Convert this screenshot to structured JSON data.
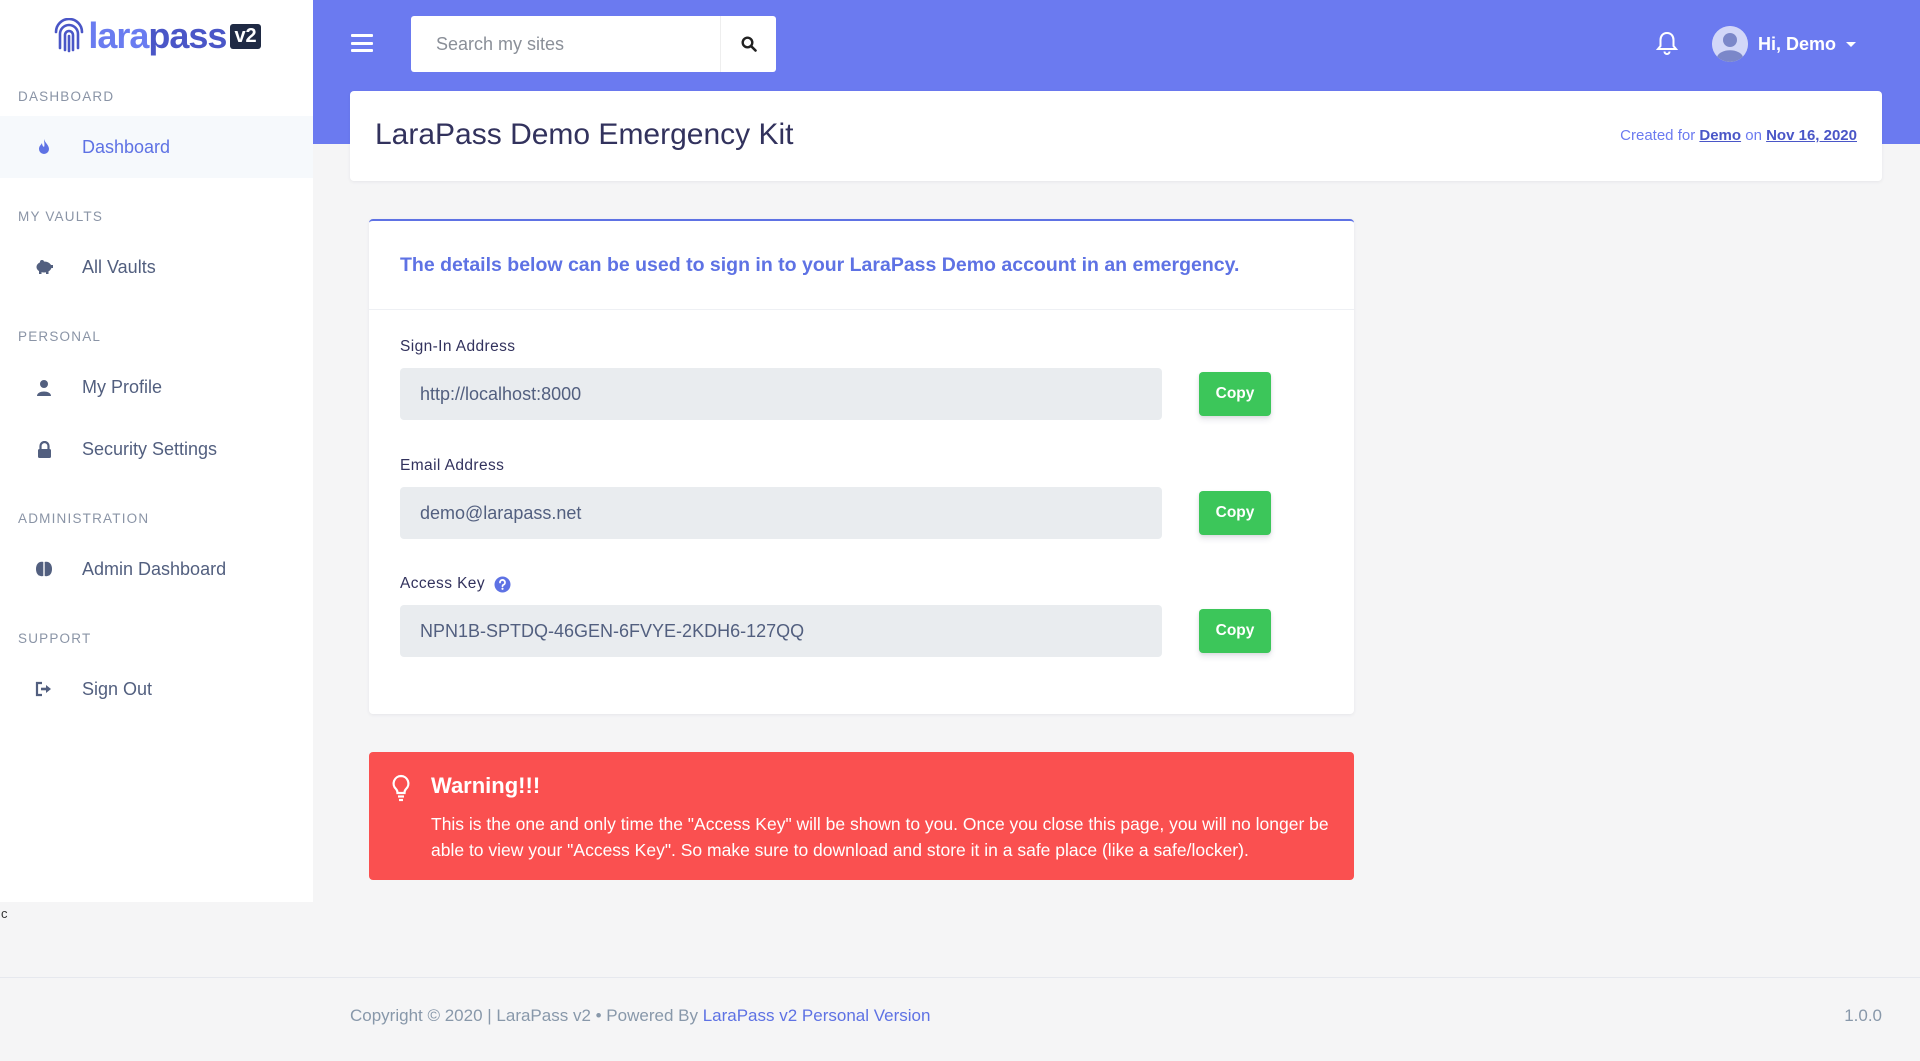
{
  "brand": {
    "name_part1": "lara",
    "name_part2": "pass",
    "version_badge": "v2"
  },
  "sidebar": {
    "sections": [
      {
        "heading": "Dashboard",
        "items": [
          {
            "label": "Dashboard",
            "icon": "flame-icon",
            "active": true
          }
        ]
      },
      {
        "heading": "My Vaults",
        "items": [
          {
            "label": "All Vaults",
            "icon": "piggy-bank-icon"
          }
        ]
      },
      {
        "heading": "Personal",
        "items": [
          {
            "label": "My Profile",
            "icon": "user-icon"
          },
          {
            "label": "Security Settings",
            "icon": "lock-icon"
          }
        ]
      },
      {
        "heading": "Administration",
        "items": [
          {
            "label": "Admin Dashboard",
            "icon": "brain-icon"
          }
        ]
      },
      {
        "heading": "Support",
        "items": [
          {
            "label": "Sign Out",
            "icon": "sign-out-icon"
          }
        ]
      }
    ],
    "stray_text": "c"
  },
  "header": {
    "search_placeholder": "Search my sites",
    "greeting": "Hi, Demo"
  },
  "page": {
    "title": "LaraPass Demo Emergency Kit",
    "created_prefix": "Created for ",
    "created_user": "Demo",
    "created_mid": " on ",
    "created_date": "Nov 16, 2020"
  },
  "card": {
    "header_text": "The details below can be used to sign in to your LaraPass Demo account in an emergency.",
    "fields": [
      {
        "label": "Sign-In Address",
        "value": "http://localhost:8000",
        "button": "Copy"
      },
      {
        "label": "Email Address",
        "value": "demo@larapass.net",
        "button": "Copy"
      },
      {
        "label": "Access Key",
        "value": "NPN1B-SPTDQ-46GEN-6FVYE-2KDH6-127QQ",
        "button": "Copy"
      }
    ]
  },
  "warning": {
    "title": "Warning!!!",
    "text": "This is the one and only time the \"Access Key\" will be shown to you. Once you close this page, you will no longer be able to view your \"Access Key\". So make sure to download and store it in a safe place (like a safe/locker)."
  },
  "footer": {
    "copyright": "Copyright © 2020 | LaraPass v2 • Powered By ",
    "link_text": "LaraPass v2 Personal Version",
    "version": "1.0.0"
  },
  "colors": {
    "accent": "#6b7af0",
    "primary": "#5e72e4",
    "success": "#3cc65a",
    "danger": "#fa5050"
  }
}
